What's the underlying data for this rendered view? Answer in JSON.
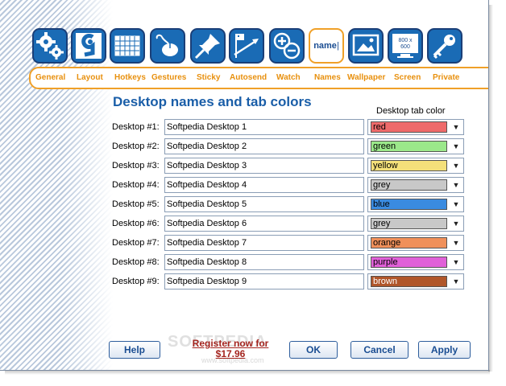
{
  "tabs": [
    {
      "label": "General",
      "icon": "gears-icon"
    },
    {
      "label": "Layout",
      "icon": "layout-nine-icon"
    },
    {
      "label": "Hotkeys",
      "icon": "keyboard-icon"
    },
    {
      "label": "Gestures",
      "icon": "mouse-icon"
    },
    {
      "label": "Sticky",
      "icon": "pushpin-icon"
    },
    {
      "label": "Autosend",
      "icon": "flag-arrow-icon"
    },
    {
      "label": "Watch",
      "icon": "zoom-plus-minus-icon"
    },
    {
      "label": "Names",
      "icon": "name-icon",
      "icon_text": "name",
      "active": true
    },
    {
      "label": "Wallpaper",
      "icon": "wallpaper-icon"
    },
    {
      "label": "Screen",
      "icon": "monitor-resolution-icon",
      "icon_text": "800 x 600"
    },
    {
      "label": "Private",
      "icon": "key-icon"
    }
  ],
  "page": {
    "title": "Desktop names and tab colors",
    "color_column_header": "Desktop tab color"
  },
  "desktops": [
    {
      "label": "Desktop #1:",
      "name": "Softpedia Desktop 1",
      "color": "red",
      "hex": "#ee6a6a"
    },
    {
      "label": "Desktop #2:",
      "name": "Softpedia Desktop 2",
      "color": "green",
      "hex": "#9be88a"
    },
    {
      "label": "Desktop #3:",
      "name": "Softpedia Desktop 3",
      "color": "yellow",
      "hex": "#f4e07a"
    },
    {
      "label": "Desktop #4:",
      "name": "Softpedia Desktop 4",
      "color": "grey",
      "hex": "#c8c8c8"
    },
    {
      "label": "Desktop #5:",
      "name": "Softpedia Desktop 5",
      "color": "blue",
      "hex": "#3a8be0"
    },
    {
      "label": "Desktop #6:",
      "name": "Softpedia Desktop 6",
      "color": "grey",
      "hex": "#c8c8c8"
    },
    {
      "label": "Desktop #7:",
      "name": "Softpedia Desktop 7",
      "color": "orange",
      "hex": "#f0905a"
    },
    {
      "label": "Desktop #8:",
      "name": "Softpedia Desktop 8",
      "color": "purple",
      "hex": "#e060d8"
    },
    {
      "label": "Desktop #9:",
      "name": "Softpedia Desktop 9",
      "color": "brown",
      "hex": "#b0562a",
      "text_color": "#ffffff"
    }
  ],
  "footer": {
    "help": "Help",
    "register_line1": "Register now for",
    "register_line2": "$17.96",
    "ok": "OK",
    "cancel": "Cancel",
    "apply": "Apply",
    "watermark": "SOFTPEDIA",
    "watermark_url": "www.softpedia.com"
  }
}
